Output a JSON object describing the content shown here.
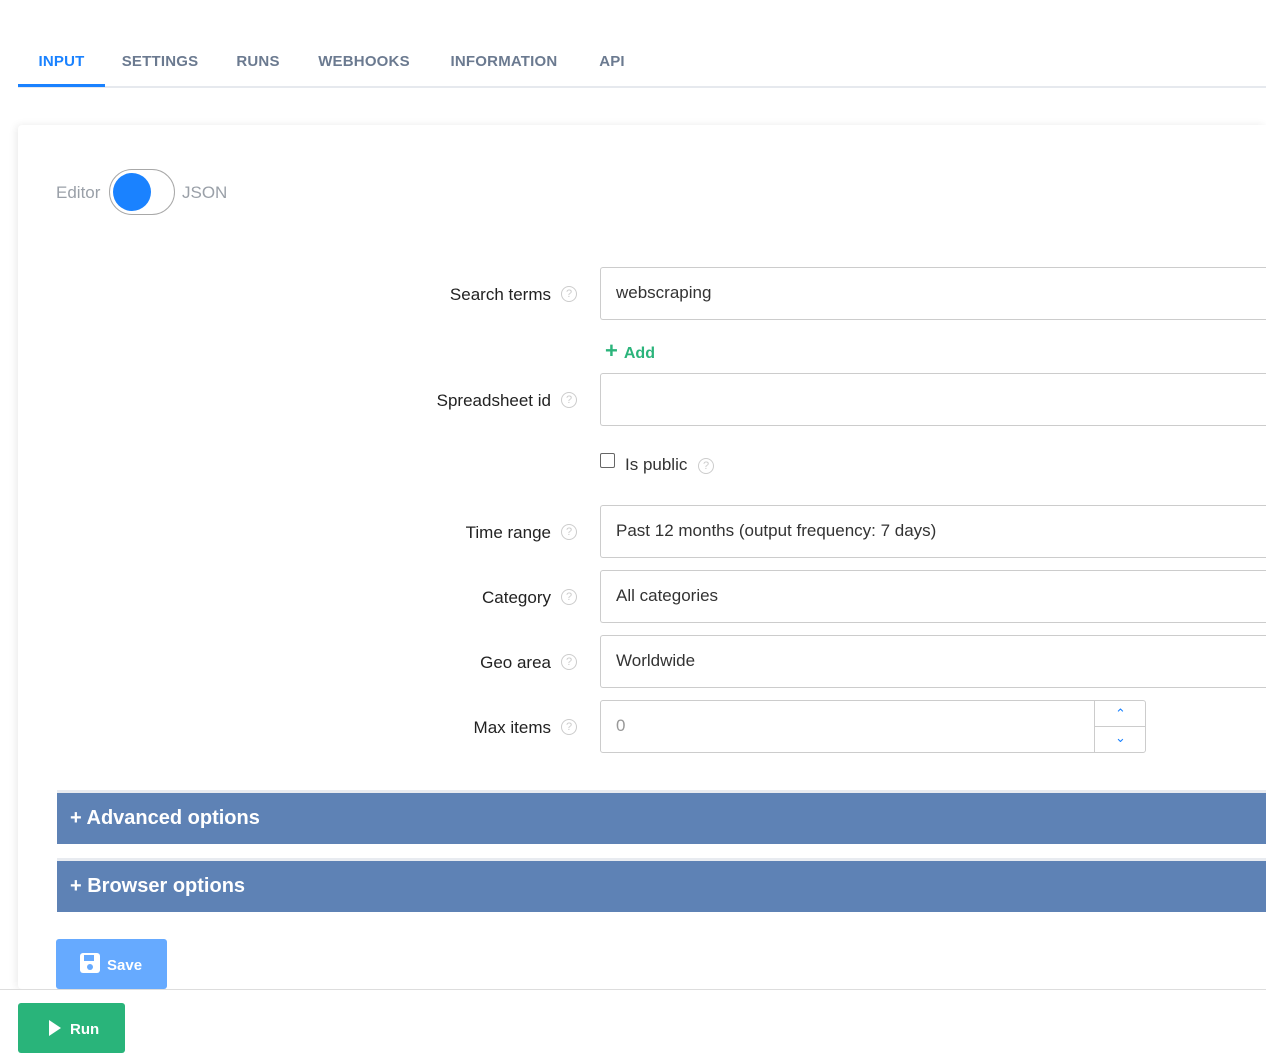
{
  "tabs": [
    {
      "label": "INPUT",
      "active": true
    },
    {
      "label": "SETTINGS"
    },
    {
      "label": "RUNS"
    },
    {
      "label": "WEBHOOKS"
    },
    {
      "label": "INFORMATION"
    },
    {
      "label": "API"
    }
  ],
  "mode": {
    "left": "Editor",
    "right": "JSON"
  },
  "fields": {
    "search_terms": {
      "label": "Search terms",
      "value": "webscraping",
      "add": "Add"
    },
    "spreadsheet_id": {
      "label": "Spreadsheet id",
      "value": ""
    },
    "is_public": {
      "label": "Is public",
      "checked": false
    },
    "time_range": {
      "label": "Time range",
      "value": "Past 12 months (output frequency: 7 days)"
    },
    "category": {
      "label": "Category",
      "value": "All categories"
    },
    "geo_area": {
      "label": "Geo area",
      "value": "Worldwide"
    },
    "max_items": {
      "label": "Max items",
      "placeholder": "0"
    }
  },
  "sections": {
    "advanced": "+ Advanced options",
    "browser": "+ Browser options"
  },
  "buttons": {
    "save": "Save",
    "run": "Run"
  },
  "colors": {
    "accent": "#1a82ff",
    "add": "#2bb47b",
    "section": "#5e82b5",
    "save": "#66aaff",
    "run": "#29b47a"
  }
}
